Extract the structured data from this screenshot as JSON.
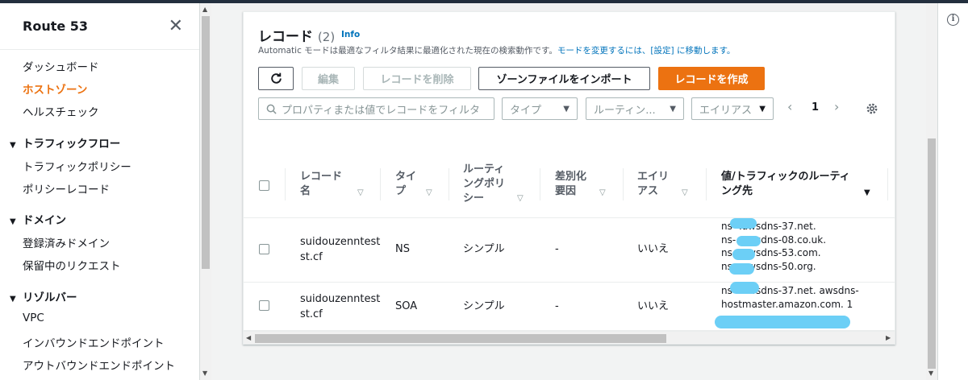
{
  "sidebar": {
    "title": "Route 53",
    "items": [
      {
        "label": "ダッシュボード"
      },
      {
        "label": "ホストゾーン"
      },
      {
        "label": "ヘルスチェック"
      }
    ],
    "sections": [
      {
        "label": "トラフィックフロー",
        "items": [
          "トラフィックポリシー",
          "ポリシーレコード"
        ]
      },
      {
        "label": "ドメイン",
        "items": [
          "登録済みドメイン",
          "保留中のリクエスト"
        ]
      },
      {
        "label": "リゾルバー",
        "items": [
          "VPC",
          "インバウンドエンドポイント",
          "アウトバウンドエンドポイント"
        ]
      }
    ]
  },
  "records": {
    "title": "レコード",
    "count": "(2)",
    "info": "Info",
    "description_prefix": "Automatic モードは最適なフィルタ結果に最適化された現在の検索動作です。",
    "description_link": "モードを変更するには、[設定] に移動します。",
    "toolbar": {
      "refresh_icon": "refresh-icon",
      "edit": "編集",
      "delete": "レコードを削除",
      "import": "ゾーンファイルをインポート",
      "create": "レコードを作成"
    },
    "filters": {
      "search_placeholder": "プロパティまたは値でレコードをフィルタ",
      "type": "タイプ",
      "routing": "ルーティン...",
      "alias": "エイリアス"
    },
    "page": "1",
    "columns": [
      [
        "レコード",
        "名"
      ],
      [
        "タイ",
        "プ"
      ],
      [
        "ルーティ",
        "ングポリ",
        "シー"
      ],
      [
        "差別化",
        "要因"
      ],
      [
        "エイリ",
        "アス"
      ],
      [
        "値/トラフィックのルーティ",
        "ング先"
      ]
    ],
    "rows": [
      {
        "name": [
          "suidouzenntest",
          "st.cf"
        ],
        "type": "NS",
        "routing": "シンプル",
        "differentiator": "-",
        "alias": "いいえ",
        "value": [
          "ns-    .awsdns-37.net.",
          "ns-    .awsdns-08.co.uk.",
          "ns-    .awsdns-53.com.",
          "ns-    .awsdns-50.org."
        ]
      },
      {
        "name": [
          "suidouzenntest",
          "st.cf"
        ],
        "type": "SOA",
        "routing": "シンプル",
        "differentiator": "-",
        "alias": "いいえ",
        "value": [
          "ns-    .awsdns-37.net. awsdns-",
          "hostmaster.amazon.com. 1"
        ]
      }
    ]
  },
  "colors": {
    "accent": "#ec7211",
    "link": "#0073bb",
    "redaction": "#6ccff6"
  }
}
